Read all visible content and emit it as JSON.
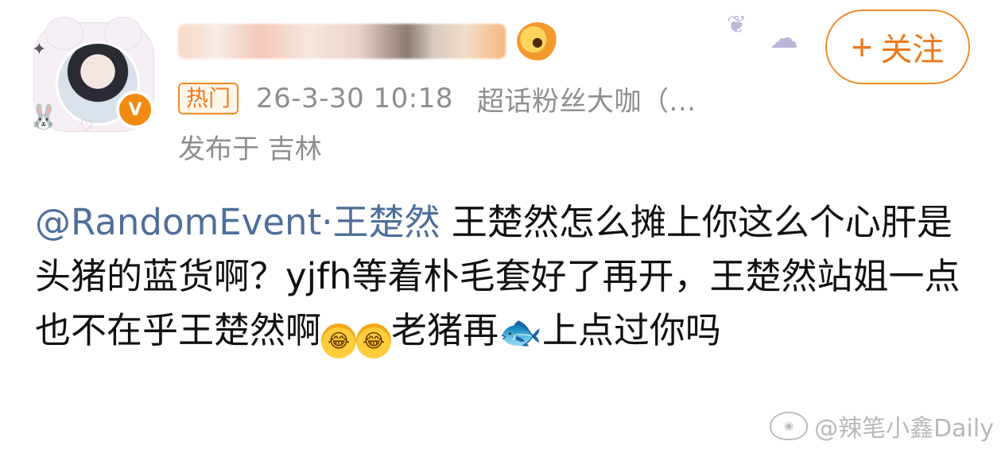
{
  "post": {
    "hot_tag": "热门",
    "time": "26-3-30 10:18",
    "source": "超话粉丝大咖（...",
    "location": "发布于 吉林",
    "follow_plus": "+",
    "follow_label": "关注",
    "content": {
      "mention": "@RandomEvent·王楚然",
      "text1": " 王楚然怎么摊上你这么个心肝是头猪的蓝货啊？yjfh等着朴毛套好了再开，王楚然站姐一点也不在乎王楚然啊",
      "text2": "老猪再",
      "text3": "上点过你吗",
      "emoji_laugh": "laughing-tears-emoji",
      "emoji_fish": "fish-emoji"
    }
  },
  "watermark": {
    "text": "@辣笔小鑫Daily"
  },
  "colors": {
    "accent_orange": "#f08a2a",
    "mention_blue": "#4e6f9a",
    "meta_gray": "#8e8e8e"
  },
  "icons": [
    "verified-v-icon",
    "fish-badge-icon",
    "weibo-logo-icon",
    "butterfly-decor-icon",
    "cloud-decor-icon"
  ]
}
